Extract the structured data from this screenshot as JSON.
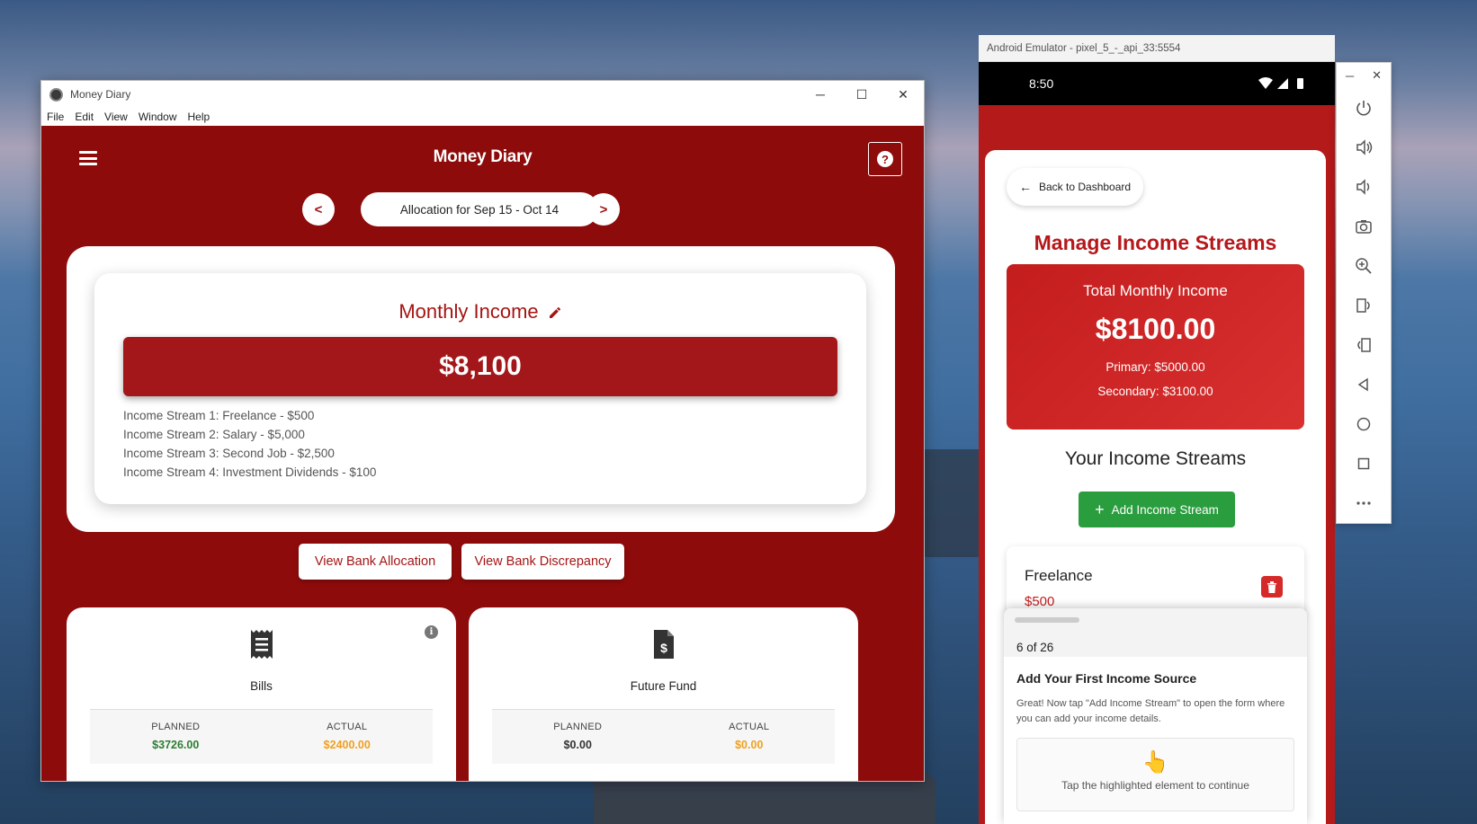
{
  "desktop_window": {
    "title": "Money Diary",
    "controls": {
      "minimize": "─",
      "maximize": "☐",
      "close": "✕"
    },
    "menu": [
      "File",
      "Edit",
      "View",
      "Window",
      "Help"
    ]
  },
  "app": {
    "title": "Money Diary",
    "help_icon": "?",
    "period": {
      "prev": "<",
      "label": "Allocation for Sep 15 - Oct 14",
      "next": ">"
    },
    "monthly_income": {
      "title": "Monthly Income",
      "amount": "$8,100",
      "streams": [
        "Income Stream 1: Freelance - $500",
        "Income Stream 2: Salary - $5,000",
        "Income Stream 3: Second Job - $2,500",
        "Income Stream 4: Investment Dividends - $100"
      ]
    },
    "actions": {
      "bank_allocation": "View Bank Allocation",
      "bank_discrepancy": "View Bank Discrepancy"
    },
    "funds": [
      {
        "title": "Bills",
        "icon": "receipt-icon",
        "planned_label": "PLANNED",
        "planned": "$3726.00",
        "actual_label": "ACTUAL",
        "actual": "$2400.00",
        "info_icon": "i"
      },
      {
        "title": "Future Fund",
        "icon": "dollar-document-icon",
        "planned_label": "PLANNED",
        "planned": "$0.00",
        "actual_label": "ACTUAL",
        "actual": "$0.00"
      }
    ]
  },
  "emulator": {
    "title": "Android Emulator - pixel_5_-_api_33:5554",
    "time": "8:50",
    "window_controls": {
      "minimize": "─",
      "close": "✕"
    },
    "back_label": "Back to Dashboard",
    "manage_title": "Manage Income Streams",
    "total": {
      "label": "Total Monthly Income",
      "amount": "$8100.00",
      "primary": "Primary: $5000.00",
      "secondary": "Secondary: $3100.00"
    },
    "your_streams_title": "Your Income Streams",
    "add_button": "Add Income Stream",
    "stream": {
      "name": "Freelance",
      "amount": "$500"
    },
    "tour": {
      "count": "6 of 26",
      "title": "Add Your First Income Source",
      "text": "Great! Now tap \"Add Income Stream\" to open the form where you can add your income details.",
      "hint": "Tap the highlighted element to continue"
    },
    "side_buttons": [
      "power-icon",
      "volume-up-icon",
      "volume-down-icon",
      "camera-icon",
      "zoom-icon",
      "rotate-left-icon",
      "rotate-right-icon",
      "back-icon",
      "home-icon",
      "overview-icon",
      "more-icon"
    ]
  },
  "colors": {
    "brand_red": "#8e0b0b",
    "accent_red": "#a51414",
    "green": "#2a9d3f",
    "planned_green": "#2e7d32",
    "actual_orange": "#f0a020"
  }
}
